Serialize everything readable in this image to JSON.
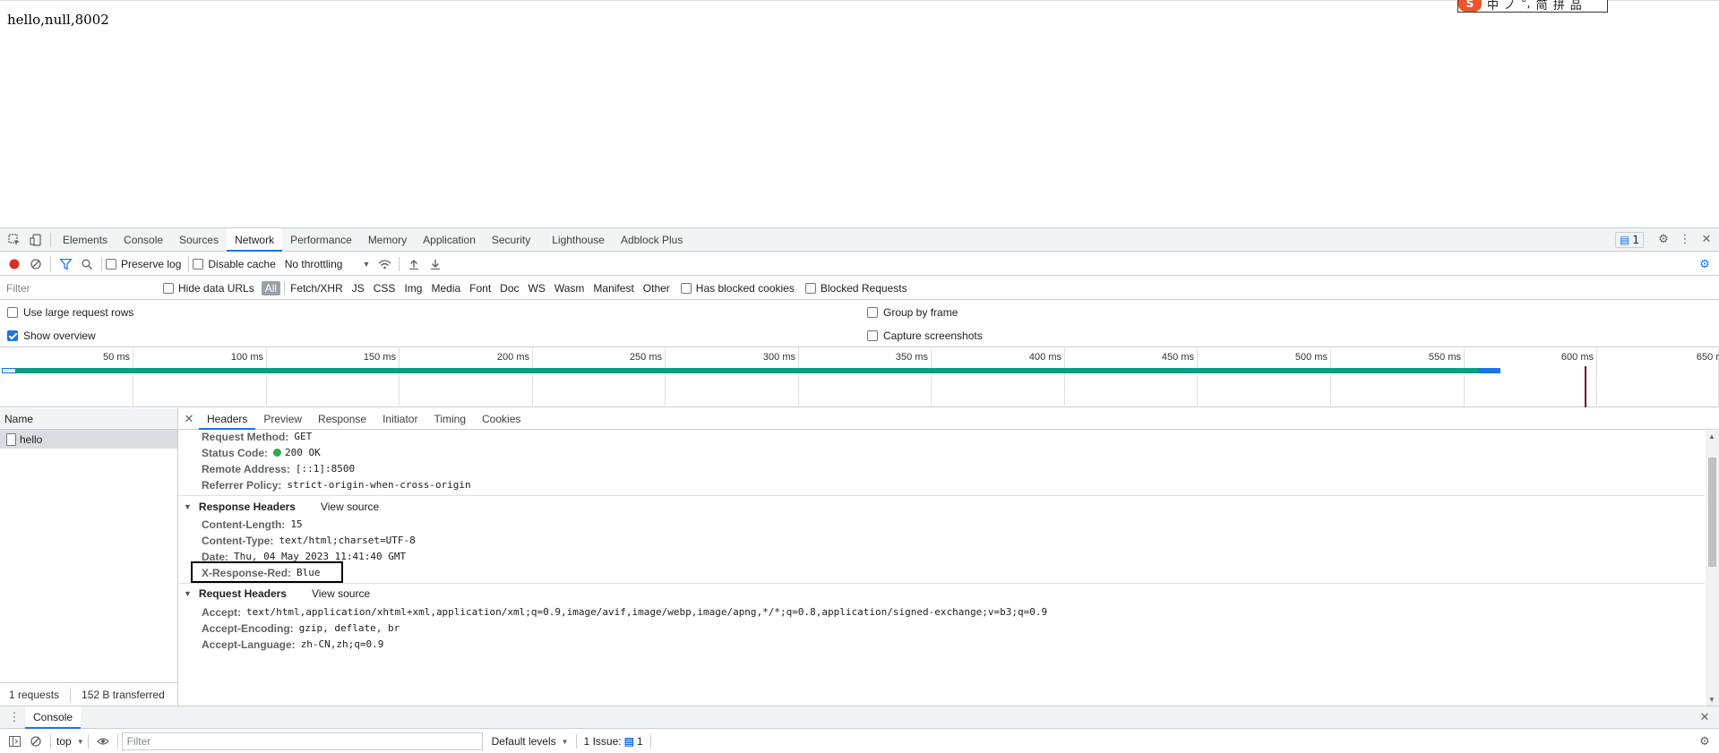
{
  "page": {
    "text": "hello,null,8002",
    "ime": {
      "logo": "S",
      "items": [
        "中",
        "ノ",
        "°,",
        "简",
        "拼",
        "品"
      ]
    }
  },
  "devtools": {
    "tabs": [
      "Elements",
      "Console",
      "Sources",
      "Network",
      "Performance",
      "Memory",
      "Application",
      "Security",
      "Lighthouse",
      "Adblock Plus"
    ],
    "issues_count": "1",
    "toolbar": {
      "preserve_log": "Preserve log",
      "disable_cache": "Disable cache",
      "throttling": "No throttling"
    },
    "filter": {
      "placeholder": "Filter",
      "hide_data_urls": "Hide data URLs",
      "types": [
        "All",
        "Fetch/XHR",
        "JS",
        "CSS",
        "Img",
        "Media",
        "Font",
        "Doc",
        "WS",
        "Wasm",
        "Manifest",
        "Other"
      ],
      "has_blocked_cookies": "Has blocked cookies",
      "blocked_requests": "Blocked Requests"
    },
    "settings": {
      "large_rows": "Use large request rows",
      "show_overview": "Show overview",
      "group_by_frame": "Group by frame",
      "capture_screenshots": "Capture screenshots"
    },
    "overview": {
      "ticks": [
        "50 ms",
        "100 ms",
        "150 ms",
        "200 ms",
        "250 ms",
        "300 ms",
        "350 ms",
        "400 ms",
        "450 ms",
        "500 ms",
        "550 ms",
        "600 ms",
        "650 r"
      ]
    },
    "request_list": {
      "header": "Name",
      "rows": [
        "hello"
      ],
      "summary_requests": "1 requests",
      "summary_transferred": "152 B transferred"
    },
    "details": {
      "tabs": [
        "Headers",
        "Preview",
        "Response",
        "Initiator",
        "Timing",
        "Cookies"
      ],
      "general": [
        {
          "key": "Request Method:",
          "value": "GET"
        },
        {
          "key": "Status Code:",
          "value": "200 OK"
        },
        {
          "key": "Remote Address:",
          "value": "[::1]:8500"
        },
        {
          "key": "Referrer Policy:",
          "value": "strict-origin-when-cross-origin"
        }
      ],
      "response_headers_title": "Response Headers",
      "request_headers_title": "Request Headers",
      "view_source": "View source",
      "response_headers": [
        {
          "key": "Content-Length:",
          "value": "15"
        },
        {
          "key": "Content-Type:",
          "value": "text/html;charset=UTF-8"
        },
        {
          "key": "Date:",
          "value": "Thu, 04 May 2023 11:41:40 GMT"
        },
        {
          "key": "X-Response-Red:",
          "value": "Blue"
        }
      ],
      "request_headers": [
        {
          "key": "Accept:",
          "value": "text/html,application/xhtml+xml,application/xml;q=0.9,image/avif,image/webp,image/apng,*/*;q=0.8,application/signed-exchange;v=b3;q=0.9"
        },
        {
          "key": "Accept-Encoding:",
          "value": "gzip, deflate, br"
        },
        {
          "key": "Accept-Language:",
          "value": "zh-CN,zh;q=0.9"
        }
      ]
    },
    "drawer": {
      "tab": "Console",
      "context": "top",
      "filter_placeholder": "Filter",
      "levels": "Default levels",
      "issues_label": "1 Issue:",
      "issues_count": "1"
    }
  }
}
